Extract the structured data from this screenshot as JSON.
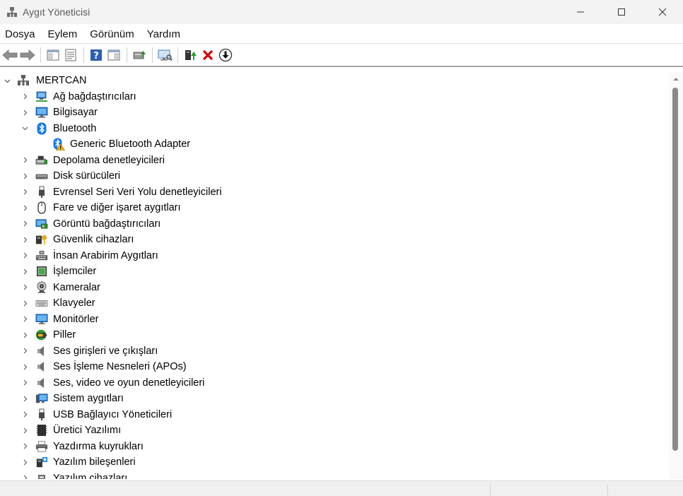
{
  "window": {
    "title": "Aygıt Yöneticisi",
    "controls": {
      "minimize": "—",
      "maximize": "☐",
      "close": "✕"
    }
  },
  "menu": [
    "Dosya",
    "Eylem",
    "Görünüm",
    "Yardım"
  ],
  "toolbar": {
    "buttons": [
      "back-icon",
      "forward-icon",
      "show-hide-console-tree-icon",
      "properties-icon",
      "help-icon",
      "action-pane-icon",
      "update-driver-icon",
      "scan-hardware-icon",
      "enable-device-icon",
      "uninstall-device-icon",
      "rollback-driver-icon"
    ]
  },
  "tree": {
    "root": "MERTCAN",
    "items": [
      {
        "label": "Ağ bağdaştırıcıları",
        "expander": "›",
        "icon": "network-adapter-icon"
      },
      {
        "label": "Bilgisayar",
        "expander": "›",
        "icon": "computer-icon"
      },
      {
        "label": "Bluetooth",
        "expander": "⌄",
        "icon": "bluetooth-icon"
      },
      {
        "label": "Generic Bluetooth Adapter",
        "expander": "",
        "icon": "bluetooth-warning-icon",
        "child": true
      },
      {
        "label": "Depolama denetleyicileri",
        "expander": "›",
        "icon": "storage-controller-icon"
      },
      {
        "label": "Disk sürücüleri",
        "expander": "›",
        "icon": "disk-drive-icon"
      },
      {
        "label": "Evrensel Seri Veri Yolu denetleyicileri",
        "expander": "›",
        "icon": "usb-controller-icon"
      },
      {
        "label": "Fare ve diğer işaret aygıtları",
        "expander": "›",
        "icon": "mouse-icon"
      },
      {
        "label": "Görüntü bağdaştırıcıları",
        "expander": "›",
        "icon": "display-adapter-icon"
      },
      {
        "label": "Güvenlik cihazları",
        "expander": "›",
        "icon": "security-device-icon"
      },
      {
        "label": "İnsan Arabirim Aygıtları",
        "expander": "›",
        "icon": "hid-icon"
      },
      {
        "label": "İşlemciler",
        "expander": "›",
        "icon": "processor-icon"
      },
      {
        "label": "Kameralar",
        "expander": "›",
        "icon": "camera-icon"
      },
      {
        "label": "Klavyeler",
        "expander": "›",
        "icon": "keyboard-icon"
      },
      {
        "label": "Monitörler",
        "expander": "›",
        "icon": "monitor-icon"
      },
      {
        "label": "Piller",
        "expander": "›",
        "icon": "battery-icon"
      },
      {
        "label": "Ses girişleri ve çıkışları",
        "expander": "›",
        "icon": "audio-io-icon"
      },
      {
        "label": "Ses İşleme Nesneleri (APOs)",
        "expander": "›",
        "icon": "audio-processing-icon"
      },
      {
        "label": "Ses, video ve oyun denetleyicileri",
        "expander": "›",
        "icon": "sound-video-icon"
      },
      {
        "label": "Sistem aygıtları",
        "expander": "›",
        "icon": "system-device-icon"
      },
      {
        "label": "USB Bağlayıcı Yöneticileri",
        "expander": "›",
        "icon": "usb-connector-icon"
      },
      {
        "label": "Üretici Yazılımı",
        "expander": "›",
        "icon": "firmware-icon"
      },
      {
        "label": "Yazdırma kuyrukları",
        "expander": "›",
        "icon": "print-queue-icon"
      },
      {
        "label": "Yazılım bileşenleri",
        "expander": "›",
        "icon": "software-component-icon"
      },
      {
        "label": "Yazılım cihazları",
        "expander": "›",
        "icon": "software-device-icon"
      }
    ]
  },
  "colors": {
    "accent": "#0078d4",
    "warning": "#f5b700",
    "error": "#d40000"
  }
}
